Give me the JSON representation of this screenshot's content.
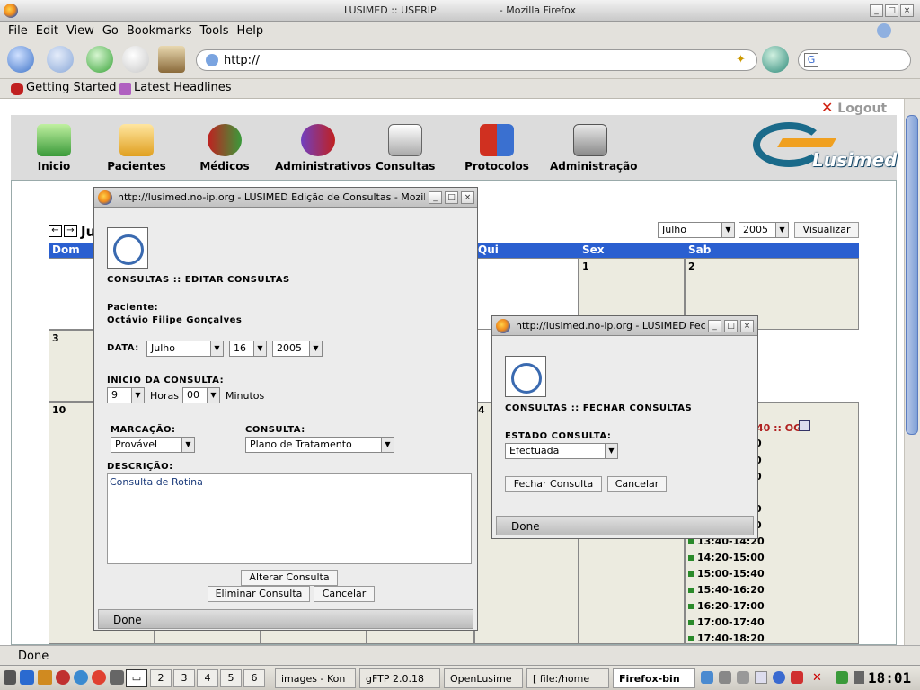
{
  "window": {
    "title": "LUSIMED :: USERIP:",
    "title_right": "- Mozilla Firefox"
  },
  "menu": [
    "File",
    "Edit",
    "View",
    "Go",
    "Bookmarks",
    "Tools",
    "Help"
  ],
  "url": "http://",
  "bookmarks": [
    "Getting Started",
    "Latest Headlines"
  ],
  "logout": "Logout",
  "app_nav": [
    "Inicio",
    "Pacientes",
    "Médicos",
    "Administrativos",
    "Consultas",
    "Protocolos",
    "Administração"
  ],
  "logo": "Lusimed",
  "calendar": {
    "month_title_fragment": "Ju",
    "month_select": "Julho",
    "year_select": "2005",
    "view_button": "Visualizar",
    "headers": {
      "dom": "Dom",
      "qui": "Qui",
      "sex": "Sex",
      "sab": "Sab"
    },
    "days": {
      "d1": "1",
      "d2": "2",
      "d3": "3",
      "d10": "10",
      "d14": "4"
    },
    "appointment_fragment": "40 :: OG",
    "slots": [
      "13:40-14:20",
      "14:20-15:00",
      "15:00-15:40",
      "15:40-16:20",
      "16:20-17:00",
      "17:00-17:40",
      "17:40-18:20"
    ],
    "slot_stubs": [
      "0",
      "0",
      "0",
      "0",
      "0"
    ]
  },
  "edit_popup": {
    "title": "http://lusimed.no-ip.org - LUSIMED Edição de Consultas - Mozilla Firef",
    "heading": "CONSULTAS :: EDITAR CONSULTAS",
    "patient_label": "Paciente:",
    "patient_name": "Octávio Filipe Gonçalves",
    "date_label": "DATA:",
    "date_month": "Julho",
    "date_day": "16",
    "date_year": "2005",
    "start_label": "INICIO DA CONSULTA:",
    "hour": "9",
    "hours_label": "Horas",
    "minute": "00",
    "minutes_label": "Minutos",
    "marcacao_label": "MARCAÇÃO:",
    "marcacao_value": "Provável",
    "consulta_label": "CONSULTA:",
    "consulta_value": "Plano de Tratamento",
    "descricao_label": "DESCRIÇÃO:",
    "descricao_value": "Consulta de Rotina",
    "alter_button": "Alterar Consulta",
    "delete_button": "Eliminar Consulta",
    "cancel_button": "Cancelar",
    "status": "Done"
  },
  "close_popup": {
    "title": "http://lusimed.no-ip.org - LUSIMED Fechar",
    "heading": "CONSULTAS :: FECHAR CONSULTAS",
    "state_label": "ESTADO CONSULTA:",
    "state_value": "Efectuada",
    "close_button": "Fechar Consulta",
    "cancel_button": "Cancelar",
    "status": "Done"
  },
  "status": "Done",
  "taskbar": {
    "desktops": [
      "2",
      "3",
      "4",
      "5",
      "6"
    ],
    "tasks": [
      "images - Kon",
      "gFTP 2.0.18",
      "OpenLusime",
      "[ file:/home",
      "Firefox-bin"
    ],
    "clock": "18:01"
  }
}
